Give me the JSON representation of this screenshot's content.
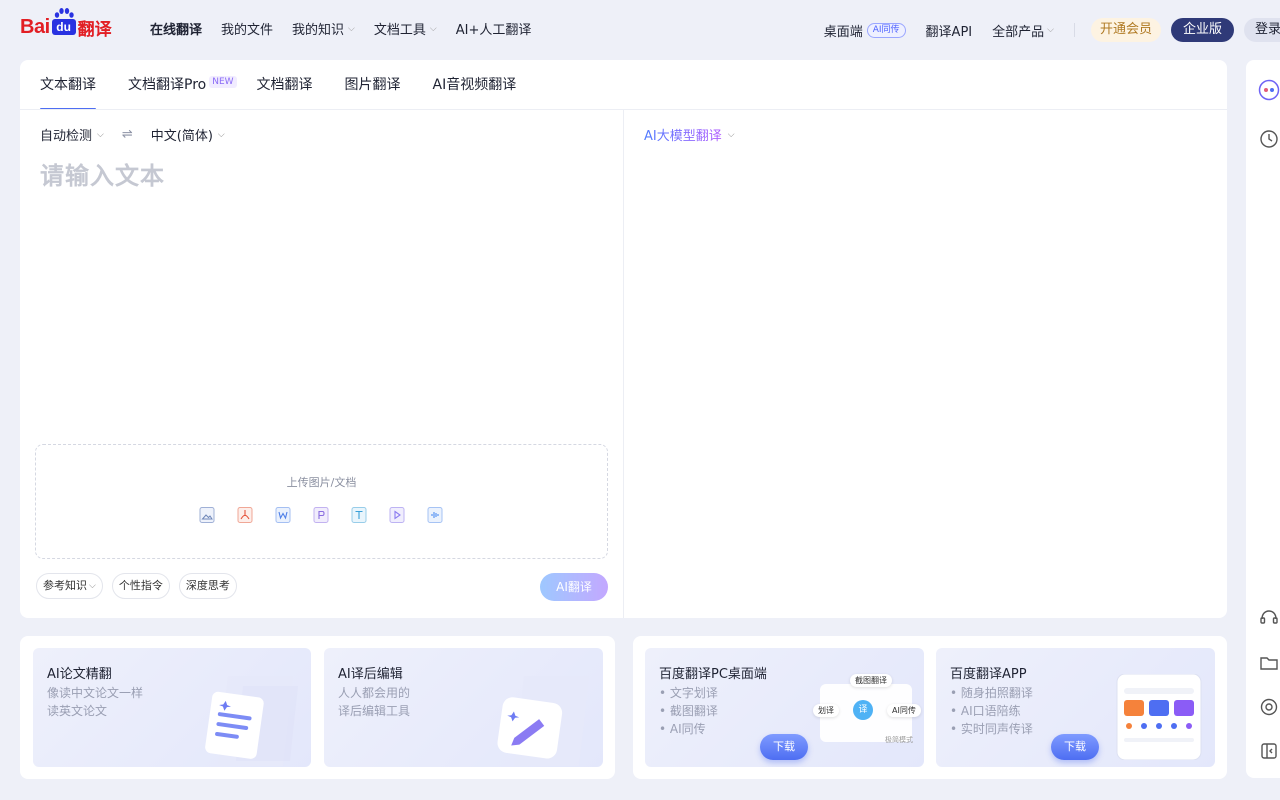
{
  "brand": {
    "bai": "Bai",
    "du": "du",
    "fanyi": "翻译"
  },
  "nav": {
    "items": [
      {
        "label": "在线翻译",
        "active": true,
        "dropdown": false
      },
      {
        "label": "我的文件",
        "active": false,
        "dropdown": false
      },
      {
        "label": "我的知识",
        "active": false,
        "dropdown": true
      },
      {
        "label": "文档工具",
        "active": false,
        "dropdown": true
      },
      {
        "label": "AI+人工翻译",
        "active": false,
        "dropdown": false
      }
    ],
    "chevron": "⌵"
  },
  "right_nav": {
    "desktop": "桌面端",
    "desktop_badge": "AI同传",
    "api": "翻译API",
    "products": "全部产品",
    "vip": "开通会员",
    "enterprise": "企业版",
    "login": "登录"
  },
  "tabs": [
    {
      "label": "文本翻译",
      "active": true,
      "tag": ""
    },
    {
      "label": "文档翻译Pro",
      "active": false,
      "tag": "NEW"
    },
    {
      "label": "文档翻译",
      "active": false,
      "tag": ""
    },
    {
      "label": "图片翻译",
      "active": false,
      "tag": ""
    },
    {
      "label": "AI音视频翻译",
      "active": false,
      "tag": ""
    }
  ],
  "source": {
    "from_lang": "自动检测",
    "swap_symbol": "⇌",
    "to_lang": "中文(简体)",
    "placeholder": "请输入文本",
    "upload_label": "上传图片/文档",
    "upload_icons": [
      {
        "name": "image-file-icon",
        "color": "#6e86b8"
      },
      {
        "name": "pdf-file-icon",
        "color": "#e5533c"
      },
      {
        "name": "word-file-icon",
        "color": "#4e7fe8"
      },
      {
        "name": "ppt-file-icon",
        "color": "#8a6de0"
      },
      {
        "name": "txt-file-icon",
        "color": "#3aa0d8"
      },
      {
        "name": "video-file-icon",
        "color": "#8c7cf0"
      },
      {
        "name": "audio-file-icon",
        "color": "#4e8ef2"
      }
    ],
    "tools": {
      "knowledge": "参考知识",
      "instruction": "个性指令",
      "deep_think": "深度思考"
    },
    "translate_button": "AI翻译"
  },
  "target": {
    "model": "AI大模型翻译"
  },
  "promos_left": [
    {
      "title": "AI论文精翻",
      "desc": [
        "像读中文论文一样",
        "读英文论文"
      ]
    },
    {
      "title": "AI译后编辑",
      "desc": [
        "人人都会用的",
        "译后编辑工具"
      ]
    }
  ],
  "promos_right": [
    {
      "title": "百度翻译PC桌面端",
      "desc": [
        "• 文字划译",
        "• 截图翻译",
        "• AI同传"
      ],
      "button": "下载",
      "mock": {
        "screenshot": "截图翻译",
        "highlight": "划译",
        "interp": "AI同传",
        "mode": "极简模式"
      }
    },
    {
      "title": "百度翻译APP",
      "desc": [
        "• 随身拍照翻译",
        "• AI口语陪练",
        "• 实时同声传译"
      ],
      "button": "下载"
    }
  ],
  "colors": {
    "accent": "#4e6ef2",
    "brand_red": "#e21e24",
    "brand_blue": "#2932e1",
    "enterprise": "#2f3a78"
  }
}
